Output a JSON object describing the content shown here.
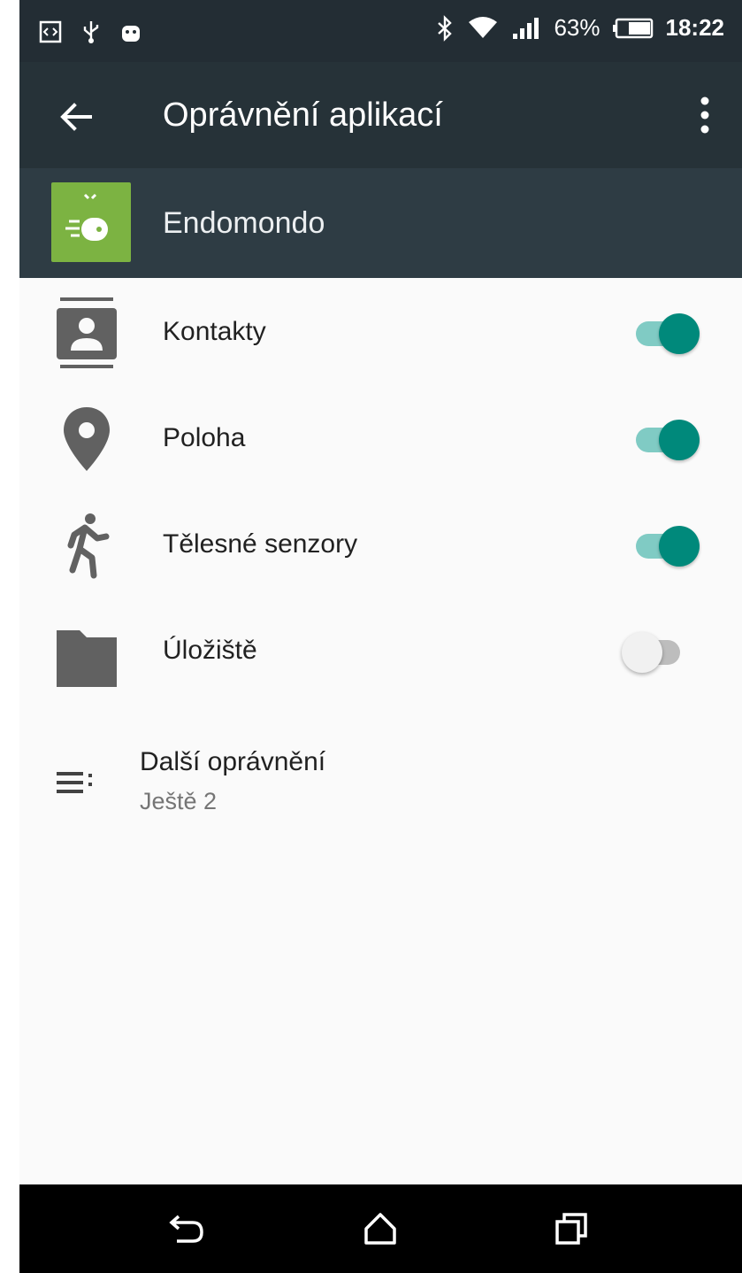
{
  "status_bar": {
    "battery_percent": "63%",
    "time": "18:22",
    "left_icons": [
      "code-icon",
      "usb-icon",
      "android-icon"
    ],
    "right_icons": [
      "bluetooth-icon",
      "wifi-icon",
      "signal-icon",
      "battery-icon"
    ]
  },
  "toolbar": {
    "title": "Oprávnění aplikací",
    "back_icon": "arrow-back-icon",
    "menu_icon": "more-vert-icon"
  },
  "app": {
    "name": "Endomondo",
    "icon_color": "#7cb342"
  },
  "permissions": [
    {
      "label": "Kontakty",
      "icon": "contacts-icon",
      "enabled": true
    },
    {
      "label": "Poloha",
      "icon": "location-icon",
      "enabled": true
    },
    {
      "label": "Tělesné senzory",
      "icon": "body-sensors-icon",
      "enabled": true
    },
    {
      "label": "Úložiště",
      "icon": "folder-icon",
      "enabled": false
    }
  ],
  "more_permissions": {
    "title": "Další oprávnění",
    "subtitle": "Ještě 2",
    "icon": "list-icon"
  },
  "nav_bar": {
    "buttons": [
      "back-nav-icon",
      "home-nav-icon",
      "recents-nav-icon"
    ]
  },
  "colors": {
    "toolbar": "#263238",
    "app_header": "#2e3c44",
    "toggle_on": "#00897b",
    "toggle_track_on": "#80cbc4"
  }
}
